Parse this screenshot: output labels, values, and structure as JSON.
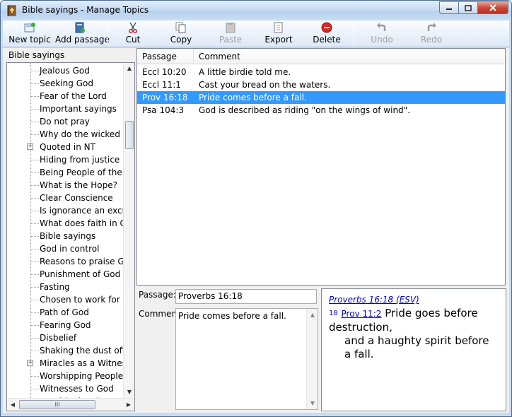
{
  "window": {
    "title": "Bible sayings - Manage Topics"
  },
  "toolbar": {
    "new_topic": "New topic",
    "add_passage": "Add passage",
    "cut": "Cut",
    "copy": "Copy",
    "paste": "Paste",
    "export": "Export",
    "delete": "Delete",
    "undo": "Undo",
    "redo": "Redo"
  },
  "tree": {
    "header": "Bible sayings",
    "items": [
      "Jealous God",
      "Seeking God",
      "Fear of the Lord",
      "Important sayings",
      "Do not pray",
      "Why do the wicked pr",
      "Quoted in NT",
      "Hiding from justice",
      "Being People of the Lo",
      "What is the Hope?",
      "Clear Conscience",
      "Is ignorance an excuse",
      "What does faith in Chr",
      "Bible sayings",
      "God in control",
      "Reasons to praise God",
      "Punishment of God",
      "Fasting",
      "Chosen to work for Go",
      "Path of God",
      "Fearing God",
      "Disbelief",
      "Shaking the dust off th",
      "Miracles as a Witness",
      "Worshipping People",
      "Witnesses to God",
      "Outside the city"
    ],
    "expandable_symbol": "+",
    "hscroll_grip": "III"
  },
  "list": {
    "headers": {
      "passage": "Passage",
      "comment": "Comment"
    },
    "rows": [
      {
        "passage": "Eccl 10:20",
        "comment": "A little birdie told me."
      },
      {
        "passage": "Eccl 11:1",
        "comment": "Cast your bread on the waters."
      },
      {
        "passage": "Prov 16:18",
        "comment": "Pride comes before a fall."
      },
      {
        "passage": "Psa 104:3",
        "comment": "God is described as riding \"on the wings of wind\"."
      }
    ]
  },
  "editor": {
    "passage_label": "Passage:",
    "passage_value": "Proverbs 16:18",
    "comment_label": "Comment:",
    "comment_value": "Pride comes before a fall."
  },
  "preview": {
    "reference": "Proverbs 16:18 (ESV)",
    "verse_number": "18",
    "cross_ref": "Prov 11:2",
    "line1": "Pride goes before destruction,",
    "line2": "and a haughty spirit before a fall."
  },
  "colors": {
    "selection": "#3399ff",
    "link": "#0000cc"
  }
}
